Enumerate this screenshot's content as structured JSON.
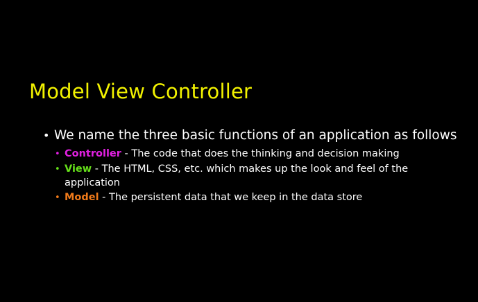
{
  "slide": {
    "title": "Model View Controller",
    "bullet": "We name the three basic functions of an application as follows",
    "items": [
      {
        "term": "Controller",
        "description": " - The code that does the thinking and decision making",
        "color": "#e020e0"
      },
      {
        "term": "View",
        "description": " - The HTML, CSS, etc. which makes up the look and feel of the application",
        "color": "#66e01a"
      },
      {
        "term": "Model",
        "description": " - The persistent data that we keep in the data store",
        "color": "#f07a1a"
      }
    ],
    "colors": {
      "background": "#000000",
      "title": "#f2f200",
      "text": "#ffffff"
    }
  }
}
